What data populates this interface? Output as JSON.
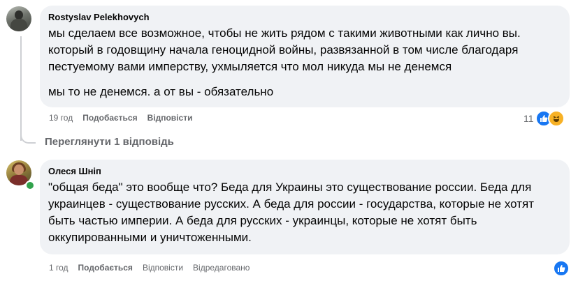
{
  "comment1": {
    "author": "Rostyslav Pelekhovych",
    "paragraphs": [
      "мы сделаем все возможное, чтобы не жить рядом с такими животными как лично вы. который в годовщину начала геноцидной войны, развязанной в том числе благодаря пестуемому вами имперству, ухмыляется что мол никуда мы не денемся",
      "мы то не денемся. а от вы - обязательно"
    ],
    "time": "19 год",
    "like_label": "Подобається",
    "reply_label": "Відповісти",
    "reaction_count": "11",
    "reaction_icons": [
      "like-icon",
      "haha-icon"
    ]
  },
  "view_replies": "Переглянути 1 відповідь",
  "comment2": {
    "author": "Олеся Шніп",
    "paragraphs": [
      "\"общая беда\" это вообще что? Беда для Украины это существование россии. Беда для украинцев - существование русских. А беда для россии - государства, которые не хотят быть частью империи. А беда для русских - украинцы, которые не хотят быть оккупированными и уничтоженными."
    ],
    "time": "1 год",
    "like_label": "Подобається",
    "reply_label": "Відповісти",
    "edited_label": "Відредаговано",
    "reaction_icons": [
      "like-icon"
    ],
    "online": true
  },
  "colors": {
    "bubble": "#f0f2f5",
    "meta_text": "#65676b",
    "like_blue": "#1877f2",
    "haha_yellow": "#f7b125",
    "online_green": "#31a24c"
  }
}
